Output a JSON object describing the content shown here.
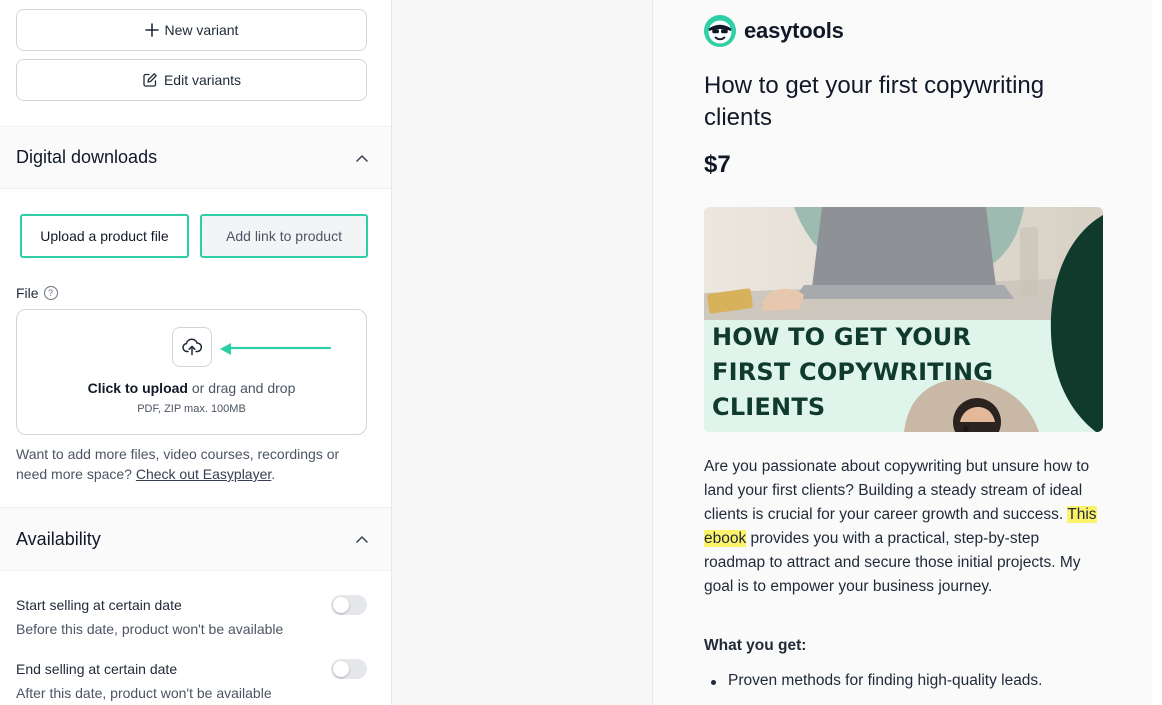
{
  "variants": {
    "new_label": "New variant",
    "edit_label": "Edit variants"
  },
  "digital_downloads": {
    "title": "Digital downloads",
    "tabs": [
      {
        "label": "Upload a product file",
        "active": true
      },
      {
        "label": "Add link to product",
        "active": false
      }
    ],
    "file_label": "File",
    "help_glyph": "?",
    "upload_icon": "cloud-upload-icon",
    "click_text": "Click to upload",
    "drag_text": " or drag and drop",
    "hint": "PDF, ZIP max. 100MB",
    "more_text": "Want to add more files, video courses, recordings or need more space? ",
    "more_link": "Check out Easyplayer",
    "more_end": "."
  },
  "availability": {
    "title": "Availability",
    "rows": [
      {
        "title": "Start selling at certain date",
        "subtitle": "Before this date, product won't be available",
        "enabled": false
      },
      {
        "title": "End selling at certain date",
        "subtitle": "After this date, product won't be available",
        "enabled": false
      }
    ]
  },
  "preview": {
    "brand": "easytools",
    "title": "How to get your first copywriting clients",
    "price": "$7",
    "cover_text": "HOW TO GET YOUR\nFIRST COPYWRITING\nCLIENTS",
    "desc_before": "Are you passionate about copywriting but unsure how to land your first clients? Building a steady stream of ideal clients is crucial for your career growth and success. ",
    "desc_highlight": "This ebook",
    "desc_after": " provides you with a practical, step-by-step roadmap to attract and secure those initial projects. My goal is to empower your business journey.",
    "subheading": "What you get:",
    "bullets": [
      "Proven methods for finding high-quality leads."
    ]
  },
  "colors": {
    "accent": "#2ecfa6",
    "highlight": "#fcf36a",
    "cover_dark": "#0f3a2c",
    "cover_mint": "#dff5ec"
  }
}
